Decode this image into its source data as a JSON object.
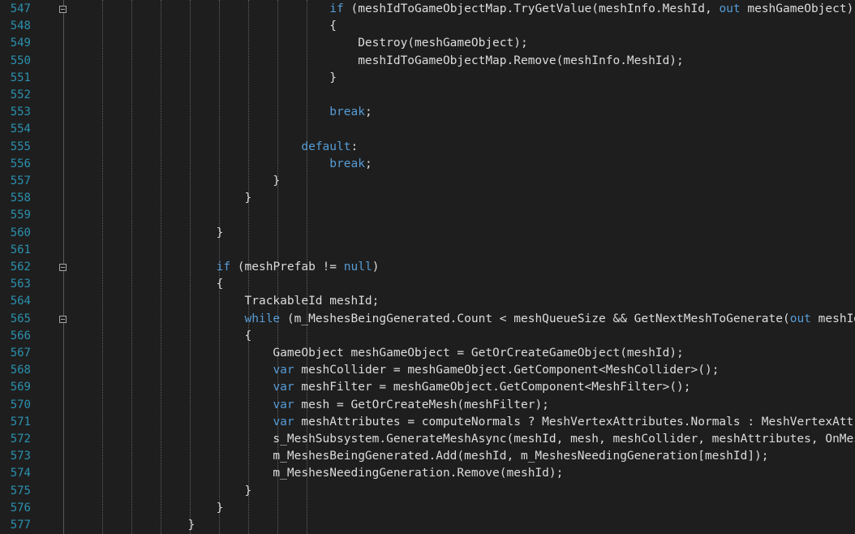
{
  "theme": {
    "background": "#1e1e1e",
    "line_number_color": "#2b91af",
    "keyword_color": "#569cd6",
    "text_color": "#dcdcdc"
  },
  "lines": [
    {
      "n": "547",
      "fold": true,
      "tokens": [
        {
          "t": "                                    "
        },
        {
          "t": "if",
          "c": "kw"
        },
        {
          "t": " (meshIdToGameObjectMap.TryGetValue(meshInfo.MeshId, "
        },
        {
          "t": "out",
          "c": "kw"
        },
        {
          "t": " meshGameObject))"
        }
      ]
    },
    {
      "n": "548",
      "fold": false,
      "tokens": [
        {
          "t": "                                    {"
        }
      ]
    },
    {
      "n": "549",
      "fold": false,
      "tokens": [
        {
          "t": "                                        Destroy(meshGameObject);"
        }
      ]
    },
    {
      "n": "550",
      "fold": false,
      "tokens": [
        {
          "t": "                                        meshIdToGameObjectMap.Remove(meshInfo.MeshId);"
        }
      ]
    },
    {
      "n": "551",
      "fold": false,
      "tokens": [
        {
          "t": "                                    }"
        }
      ]
    },
    {
      "n": "552",
      "fold": false,
      "tokens": []
    },
    {
      "n": "553",
      "fold": false,
      "tokens": [
        {
          "t": "                                    "
        },
        {
          "t": "break",
          "c": "kw"
        },
        {
          "t": ";"
        }
      ]
    },
    {
      "n": "554",
      "fold": false,
      "tokens": []
    },
    {
      "n": "555",
      "fold": false,
      "tokens": [
        {
          "t": "                                "
        },
        {
          "t": "default",
          "c": "kw"
        },
        {
          "t": ":"
        }
      ]
    },
    {
      "n": "556",
      "fold": false,
      "tokens": [
        {
          "t": "                                    "
        },
        {
          "t": "break",
          "c": "kw"
        },
        {
          "t": ";"
        }
      ]
    },
    {
      "n": "557",
      "fold": false,
      "tokens": [
        {
          "t": "                            }"
        }
      ]
    },
    {
      "n": "558",
      "fold": false,
      "tokens": [
        {
          "t": "                        }"
        }
      ]
    },
    {
      "n": "559",
      "fold": false,
      "tokens": []
    },
    {
      "n": "560",
      "fold": false,
      "tokens": [
        {
          "t": "                    }"
        }
      ]
    },
    {
      "n": "561",
      "fold": false,
      "tokens": []
    },
    {
      "n": "562",
      "fold": true,
      "tokens": [
        {
          "t": "                    "
        },
        {
          "t": "if",
          "c": "kw"
        },
        {
          "t": " (meshPrefab != "
        },
        {
          "t": "null",
          "c": "kw"
        },
        {
          "t": ")"
        }
      ]
    },
    {
      "n": "563",
      "fold": false,
      "tokens": [
        {
          "t": "                    {"
        }
      ]
    },
    {
      "n": "564",
      "fold": false,
      "tokens": [
        {
          "t": "                        TrackableId meshId;"
        }
      ]
    },
    {
      "n": "565",
      "fold": true,
      "tokens": [
        {
          "t": "                        "
        },
        {
          "t": "while",
          "c": "kw"
        },
        {
          "t": " (m_MeshesBeingGenerated.Count < meshQueueSize && GetNextMeshToGenerate("
        },
        {
          "t": "out",
          "c": "kw"
        },
        {
          "t": " meshId))"
        }
      ]
    },
    {
      "n": "566",
      "fold": false,
      "tokens": [
        {
          "t": "                        {"
        }
      ]
    },
    {
      "n": "567",
      "fold": false,
      "tokens": [
        {
          "t": "                            GameObject meshGameObject = GetOrCreateGameObject(meshId);"
        }
      ]
    },
    {
      "n": "568",
      "fold": false,
      "tokens": [
        {
          "t": "                            "
        },
        {
          "t": "var",
          "c": "kw"
        },
        {
          "t": " meshCollider = meshGameObject.GetComponent<MeshCollider>();"
        }
      ]
    },
    {
      "n": "569",
      "fold": false,
      "tokens": [
        {
          "t": "                            "
        },
        {
          "t": "var",
          "c": "kw"
        },
        {
          "t": " meshFilter = meshGameObject.GetComponent<MeshFilter>();"
        }
      ]
    },
    {
      "n": "570",
      "fold": false,
      "tokens": [
        {
          "t": "                            "
        },
        {
          "t": "var",
          "c": "kw"
        },
        {
          "t": " mesh = GetOrCreateMesh(meshFilter);"
        }
      ]
    },
    {
      "n": "571",
      "fold": false,
      "tokens": [
        {
          "t": "                            "
        },
        {
          "t": "var",
          "c": "kw"
        },
        {
          "t": " meshAttributes = computeNormals ? MeshVertexAttributes.Normals : MeshVertexAttribute"
        }
      ]
    },
    {
      "n": "572",
      "fold": false,
      "tokens": [
        {
          "t": "                            s_MeshSubsystem.GenerateMeshAsync(meshId, mesh, meshCollider, meshAttributes, OnMeshGene"
        }
      ]
    },
    {
      "n": "573",
      "fold": false,
      "tokens": [
        {
          "t": "                            m_MeshesBeingGenerated.Add(meshId, m_MeshesNeedingGeneration[meshId]);"
        }
      ]
    },
    {
      "n": "574",
      "fold": false,
      "tokens": [
        {
          "t": "                            m_MeshesNeedingGeneration.Remove(meshId);"
        }
      ]
    },
    {
      "n": "575",
      "fold": false,
      "tokens": [
        {
          "t": "                        }"
        }
      ]
    },
    {
      "n": "576",
      "fold": false,
      "tokens": [
        {
          "t": "                    }"
        }
      ]
    },
    {
      "n": "577",
      "fold": false,
      "tokens": [
        {
          "t": "                }"
        }
      ]
    }
  ]
}
